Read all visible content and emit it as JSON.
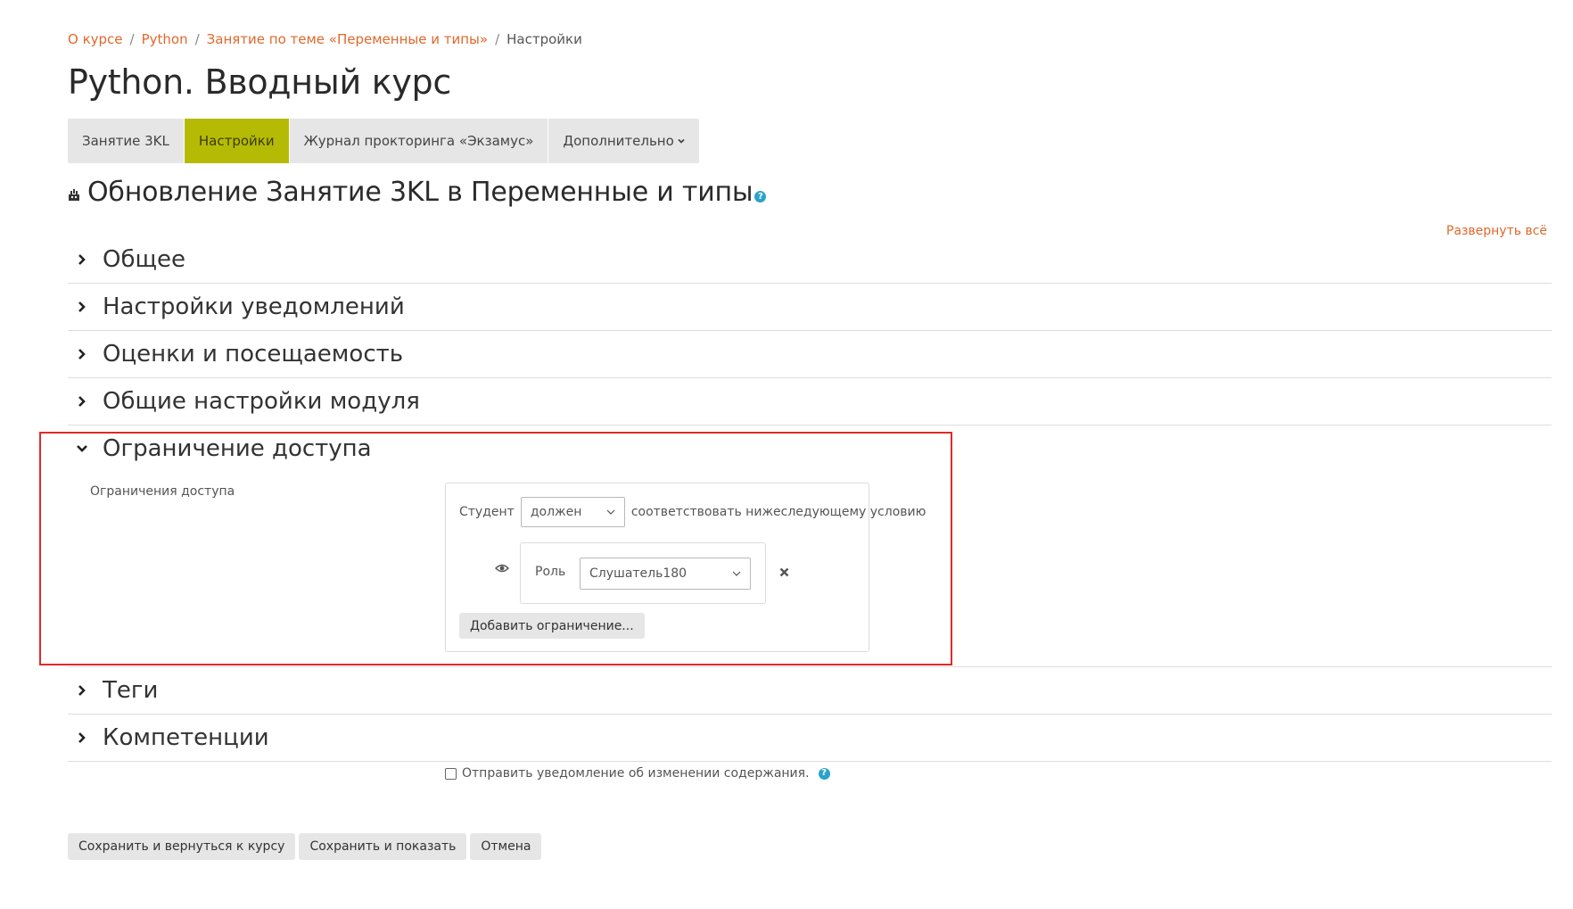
{
  "breadcrumb": {
    "items": [
      "О курсе",
      "Python",
      "Занятие по теме «Переменные и типы»"
    ],
    "current": "Настройки",
    "separator": "/"
  },
  "page_title": "Python. Вводный курс",
  "tabs": [
    {
      "label": "Занятие 3KL",
      "active": false
    },
    {
      "label": "Настройки",
      "active": true
    },
    {
      "label": "Журнал прокторинга «Экзамус»",
      "active": false
    },
    {
      "label": "Дополнительно",
      "active": false,
      "has_dropdown": true
    }
  ],
  "activity_heading": {
    "icon": "activity-module-icon",
    "title": "Обновление Занятие 3KL в Переменные и типы",
    "help_icon": "?"
  },
  "expand_all": "Развернуть всё",
  "sections": [
    {
      "title": "Общее",
      "expanded": false
    },
    {
      "title": "Настройки уведомлений",
      "expanded": false
    },
    {
      "title": "Оценки и посещаемость",
      "expanded": false
    },
    {
      "title": "Общие настройки модуля",
      "expanded": false
    },
    {
      "title": "Ограничение доступа",
      "expanded": true
    },
    {
      "title": "Теги",
      "expanded": false
    },
    {
      "title": "Компетенции",
      "expanded": false
    }
  ],
  "restriction": {
    "label": "Ограничения доступа",
    "student_label": "Студент",
    "must_select": "должен",
    "condition_text": "соответствовать нижеследующему условию",
    "role_label": "Роль",
    "role_value": "Слушатель180",
    "add_button": "Добавить ограничение..."
  },
  "notify": {
    "label": "Отправить уведомление об изменении содержания.",
    "checked": false
  },
  "buttons": {
    "save_return": "Сохранить и вернуться к курсу",
    "save_display": "Сохранить и показать",
    "cancel": "Отмена"
  },
  "colors": {
    "link": "#e0682b",
    "active_tab": "#b5bb05",
    "help": "#2ba3c9",
    "highlight_border": "#e02a2a"
  }
}
